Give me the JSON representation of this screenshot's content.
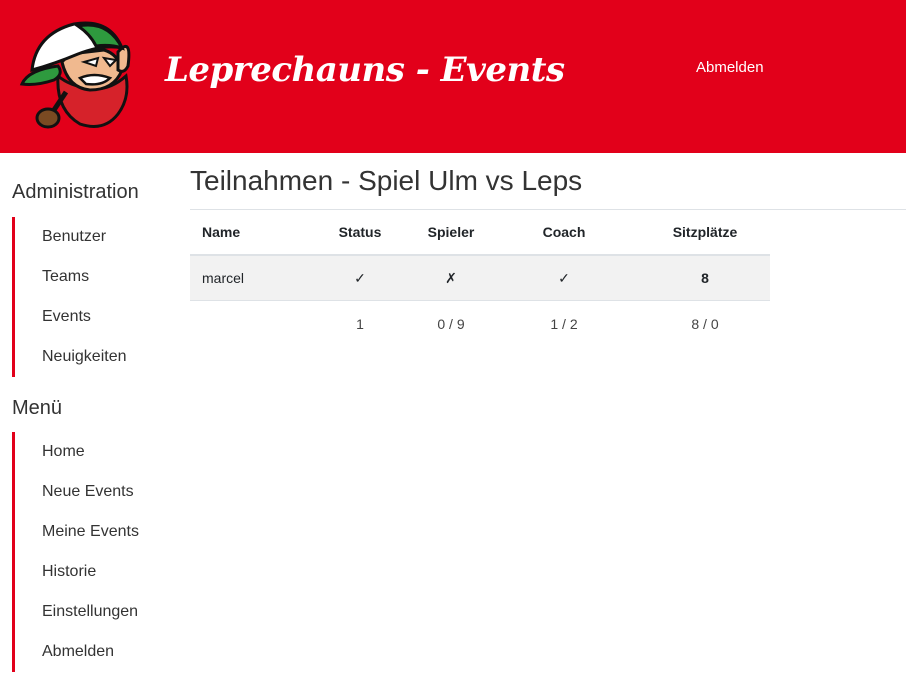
{
  "header": {
    "brand": "Leprechauns - Events",
    "logout": "Abmelden"
  },
  "sidebar": {
    "sections": [
      {
        "title": "Administration",
        "items": [
          {
            "label": "Benutzer"
          },
          {
            "label": "Teams"
          },
          {
            "label": "Events"
          },
          {
            "label": "Neuigkeiten"
          }
        ]
      },
      {
        "title": "Menü",
        "items": [
          {
            "label": "Home"
          },
          {
            "label": "Neue Events"
          },
          {
            "label": "Meine Events"
          },
          {
            "label": "Historie"
          },
          {
            "label": "Einstellungen"
          },
          {
            "label": "Abmelden"
          }
        ]
      }
    ]
  },
  "main": {
    "title": "Teilnahmen - Spiel Ulm vs Leps",
    "table": {
      "headers": [
        "Name",
        "Status",
        "Spieler",
        "Coach",
        "Sitzplätze"
      ],
      "rows": [
        {
          "name": "marcel",
          "status": "✓",
          "spieler": "✗",
          "coach": "✓",
          "sitz": "8"
        }
      ],
      "summary": {
        "name": "",
        "status": "1",
        "spieler": "0 / 9",
        "coach": "1 / 2",
        "sitz": "8 / 0"
      }
    }
  },
  "colors": {
    "brand_red": "#e2001a",
    "text": "#212529",
    "row_bg": "#f2f2f2"
  },
  "icons": {
    "logo": "leprechaun-logo"
  }
}
